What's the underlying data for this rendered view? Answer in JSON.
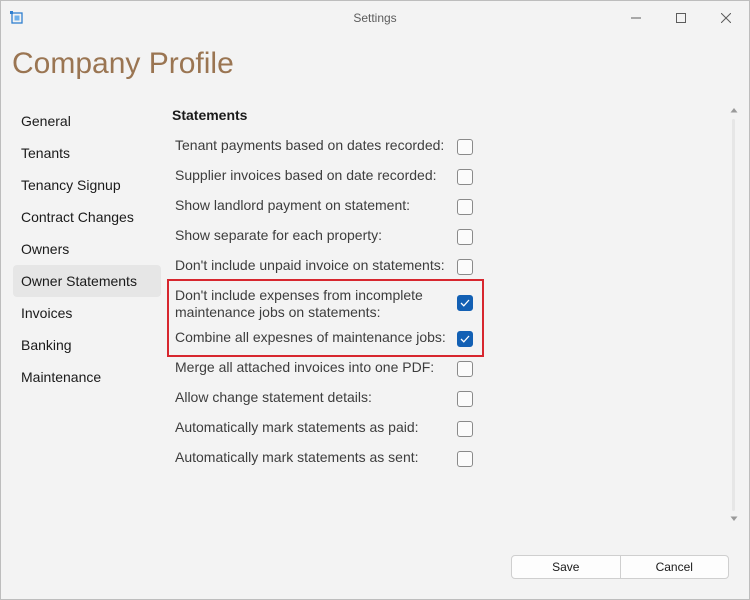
{
  "window": {
    "title": "Settings"
  },
  "page": {
    "title": "Company Profile"
  },
  "sidebar": {
    "items": [
      {
        "label": "General",
        "selected": false
      },
      {
        "label": "Tenants",
        "selected": false
      },
      {
        "label": "Tenancy Signup",
        "selected": false
      },
      {
        "label": "Contract Changes",
        "selected": false
      },
      {
        "label": "Owners",
        "selected": false
      },
      {
        "label": "Owner Statements",
        "selected": true
      },
      {
        "label": "Invoices",
        "selected": false
      },
      {
        "label": "Banking",
        "selected": false
      },
      {
        "label": "Maintenance",
        "selected": false
      }
    ]
  },
  "statements": {
    "title": "Statements",
    "options": [
      {
        "label": "Tenant payments based on dates recorded:",
        "checked": false
      },
      {
        "label": "Supplier invoices based on date recorded:",
        "checked": false
      },
      {
        "label": "Show landlord payment on statement:",
        "checked": false
      },
      {
        "label": "Show separate for each property:",
        "checked": false
      },
      {
        "label": "Don't include unpaid invoice on statements:",
        "checked": false
      },
      {
        "label": "Don't include expenses from incomplete maintenance jobs on statements:",
        "checked": true
      },
      {
        "label": "Combine all expesnes of maintenance jobs:",
        "checked": true
      },
      {
        "label": "Merge all attached invoices into one PDF:",
        "checked": false
      },
      {
        "label": "Allow change statement details:",
        "checked": false
      },
      {
        "label": "Automatically mark statements as paid:",
        "checked": false
      },
      {
        "label": "Automatically mark statements as sent:",
        "checked": false
      }
    ]
  },
  "footer": {
    "save_label": "Save",
    "cancel_label": "Cancel"
  },
  "colors": {
    "accent": "#1360b4",
    "title": "#9a7552",
    "highlight": "#d7262e"
  }
}
